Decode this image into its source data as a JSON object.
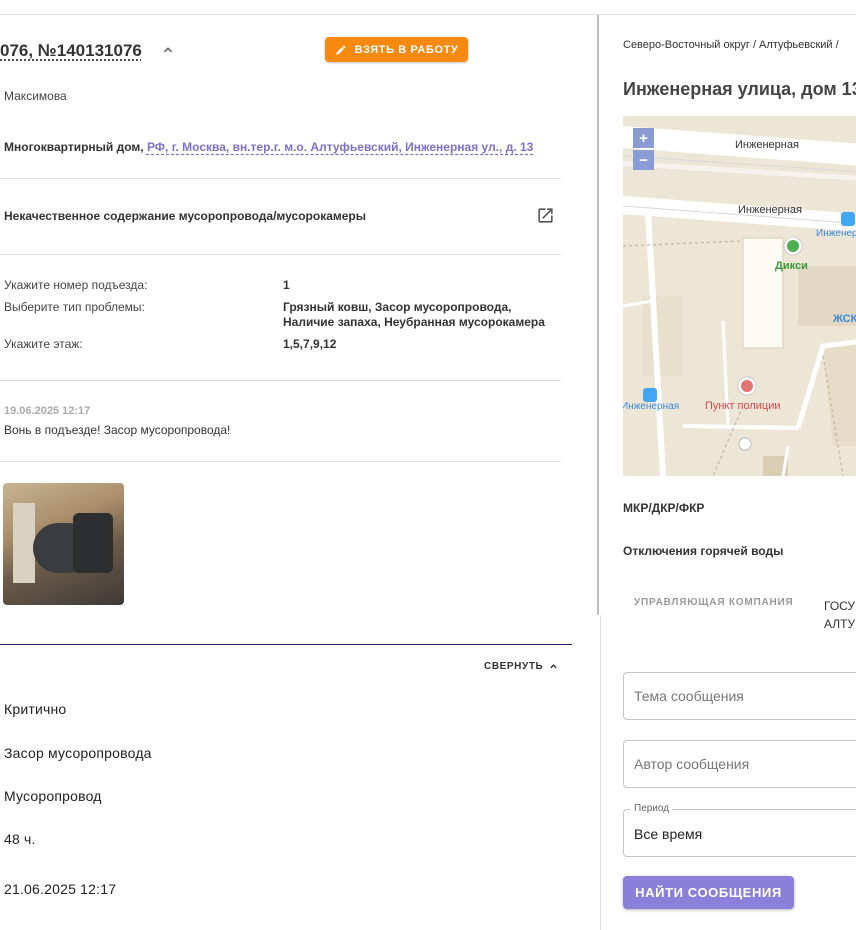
{
  "ticket": {
    "title": "076, №140131076",
    "take_button": "ВЗЯТЬ В РАБОТУ",
    "author": "Максимова",
    "housing_type": "Многоквартирный дом,",
    "address": "РФ, г. Москва, вн.тер.г. м.о. Алтуфьевский, Инженерная ул., д. 13",
    "category": "Некачественное содержание мусоропровода/мусорокамеры",
    "fields": [
      {
        "label": "Укажите номер подъезда:",
        "value": "1"
      },
      {
        "label": "Выберите тип проблемы:",
        "value": "Грязный ковш, Засор мусоропровода, Наличие запаха, Неубранная мусорокамера"
      },
      {
        "label": "Укажите этаж:",
        "value": "1,5,7,9,12"
      }
    ],
    "comment": {
      "date": "19.06.2025 12:17",
      "text": "Вонь в подъезде! Засор мусоропровода!"
    },
    "collapse_label": "СВЕРНУТЬ",
    "props": [
      "Критично",
      "Засор мусоропровода",
      "Мусоропровод",
      "48 ч.",
      "21.06.2025 12:17"
    ]
  },
  "side": {
    "breadcrumb": "Северо-Восточный округ / Алтуфьевский /",
    "title": "Инженерная улица, дом 13",
    "map": {
      "zoom_in": "+",
      "zoom_out": "−",
      "labels": {
        "street1": "Инженерная",
        "street2": "Инженерная",
        "stop_right": "Инженер",
        "shop": "Дикси",
        "zhsk": "ЖСК",
        "stop_left": "Инженерная",
        "police": "Пункт полиции"
      }
    },
    "mkr": "МКР/ДКР/ФКР",
    "hot_water": "Отключения горячей воды",
    "uk_label": "УПРАВЛЯЮЩАЯ КОМПАНИЯ",
    "uk_value_1": "ГОСУ",
    "uk_value_2": "АЛТУ",
    "topic_placeholder": "Тема сообщения",
    "author_placeholder": "Автор сообщения",
    "period_label": "Период",
    "period_value": "Все время",
    "find_button": "НАЙТИ СООБЩЕНИЯ"
  },
  "colors": {
    "accent_orange": "#f7890e",
    "accent_purple": "#8b80d9",
    "link": "#7b72c7"
  }
}
